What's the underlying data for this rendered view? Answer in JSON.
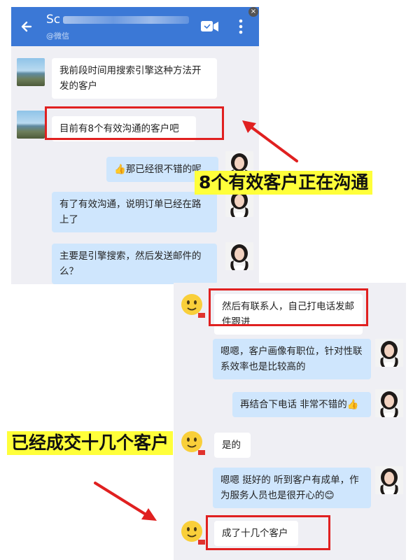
{
  "top_chat": {
    "header": {
      "title_prefix": "Sc",
      "subtitle": "@微信",
      "back_icon": "arrow-left-icon",
      "video_icon": "video-call-icon",
      "more_icon": "more-vertical-icon",
      "bar_color": "#3b78d6"
    },
    "close_glyph": "×",
    "messages": [
      {
        "side": "left",
        "text": "我前段时间用搜索引擎这种方法开发的客户"
      },
      {
        "side": "left",
        "text": "目前有8个有效沟通的客户吧",
        "highlighted": true
      },
      {
        "side": "right",
        "text": "那已经很不错的呢",
        "emoji": "👍"
      },
      {
        "side": "right",
        "text": "有了有效沟通，说明订单已经在路上了"
      },
      {
        "side": "right",
        "text": "主要是引擎搜索，然后发送邮件的么？"
      }
    ]
  },
  "bottom_chat": {
    "messages": [
      {
        "side": "left",
        "text": "然后有联系人，自己打电话发邮件跟进",
        "highlighted": true
      },
      {
        "side": "right",
        "text": "嗯嗯，客户画像有职位，针对性联系效率也是比较高的"
      },
      {
        "side": "right",
        "text": "再结合下电话 非常不错的",
        "emoji": "👍"
      },
      {
        "side": "left",
        "text": "是的"
      },
      {
        "side": "right",
        "text": "嗯嗯 挺好的 听到客户有成单，作为服务人员也是很开心的",
        "emoji": "😊"
      },
      {
        "side": "left",
        "text": "成了十几个客户",
        "highlighted": true
      }
    ]
  },
  "annotations": {
    "callout_top": "8个有效客户正在沟通",
    "callout_bottom": "已经成交十几个客户",
    "highlight_color": "#e02020",
    "callout_bg": "#ffff3a"
  }
}
